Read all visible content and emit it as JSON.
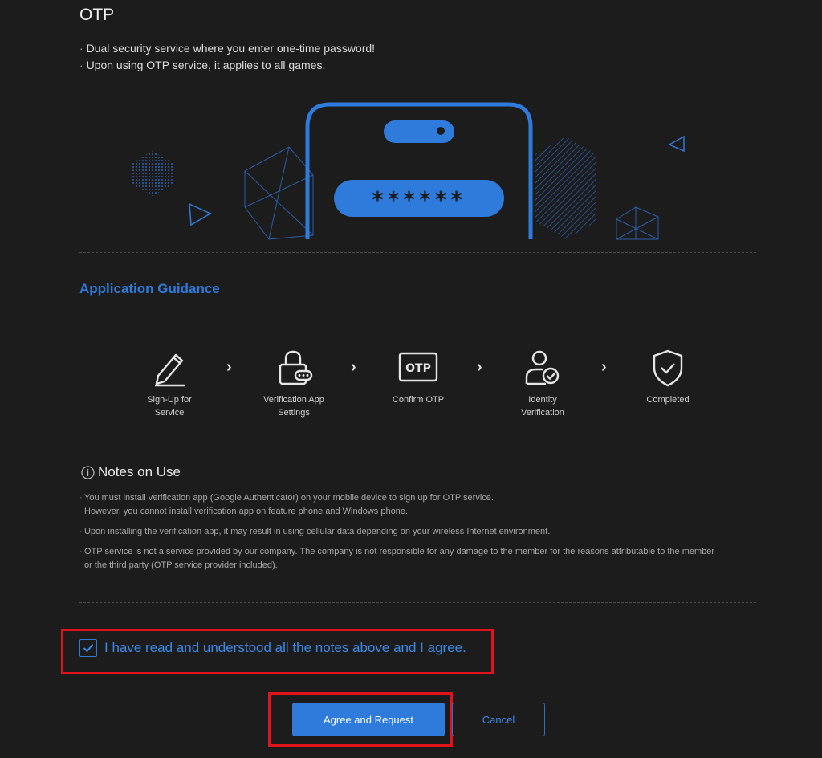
{
  "page": {
    "title": "OTP",
    "intro": [
      "Dual security service where you enter one-time password!",
      "Upon using OTP service, it applies to all games."
    ]
  },
  "hero": {
    "password_mask": "******",
    "accent_color": "#2f7bdc"
  },
  "guidance": {
    "title": "Application Guidance",
    "steps": [
      {
        "icon": "pencil-icon",
        "label_line1": "Sign-Up for",
        "label_line2": "Service"
      },
      {
        "icon": "lock-icon",
        "label_line1": "Verification App",
        "label_line2": "Settings"
      },
      {
        "icon": "otp-badge-icon",
        "icon_text": "OTP",
        "label_line1": "Confirm OTP",
        "label_line2": ""
      },
      {
        "icon": "user-check-icon",
        "label_line1": "Identity",
        "label_line2": "Verification"
      },
      {
        "icon": "shield-check-icon",
        "label_line1": "Completed",
        "label_line2": ""
      }
    ],
    "separator": "›"
  },
  "notes": {
    "title": "Notes on Use",
    "items": [
      {
        "line1": "You must install verification app (Google Authenticator) on your mobile device to sign up for OTP service.",
        "line2": "However, you cannot install verification app on feature phone and Windows phone."
      },
      {
        "line1": "Upon installing the verification app, it may result in using cellular data depending on your wireless Internet environment.",
        "line2": ""
      },
      {
        "line1": "OTP service is not a service provided by our company. The company is not responsible for any damage to the member for the reasons attributable to the member",
        "line2": "or the third party (OTP service provider included)."
      }
    ]
  },
  "agreement": {
    "checked": true,
    "text": "I have read and understood all the notes above and I agree."
  },
  "actions": {
    "primary_label": "Agree and Request",
    "cancel_label": "Cancel"
  },
  "colors": {
    "background": "#1c1c1d",
    "accent": "#2f7bdc",
    "highlight_box": "#e3131b"
  }
}
